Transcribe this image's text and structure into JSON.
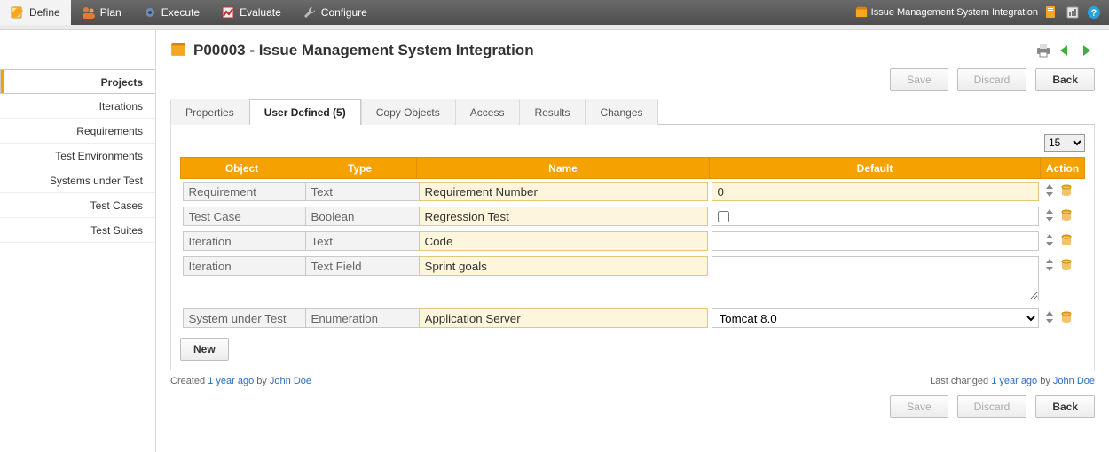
{
  "toolbar": {
    "tabs": [
      {
        "id": "define",
        "label": "Define",
        "icon": "pencil-note-icon"
      },
      {
        "id": "plan",
        "label": "Plan",
        "icon": "people-icon"
      },
      {
        "id": "execute",
        "label": "Execute",
        "icon": "gear-icon"
      },
      {
        "id": "evaluate",
        "label": "Evaluate",
        "icon": "chart-icon"
      },
      {
        "id": "configure",
        "label": "Configure",
        "icon": "wrench-icon"
      }
    ],
    "active_tab": "define",
    "context_label": "Issue Management System Integration",
    "right_icons": [
      "notes-icon",
      "reports-icon",
      "help-icon"
    ]
  },
  "sidebar": {
    "items": [
      {
        "label": "Projects"
      },
      {
        "label": "Iterations"
      },
      {
        "label": "Requirements"
      },
      {
        "label": "Test Environments"
      },
      {
        "label": "Systems under Test"
      },
      {
        "label": "Test Cases"
      },
      {
        "label": "Test Suites"
      }
    ],
    "active_index": 0
  },
  "page": {
    "title": "P00003 - Issue Management System Integration"
  },
  "actions": {
    "save_label": "Save",
    "discard_label": "Discard",
    "back_label": "Back",
    "new_label": "New"
  },
  "tabs": {
    "items": [
      {
        "label": "Properties"
      },
      {
        "label": "User Defined (5)"
      },
      {
        "label": "Copy Objects"
      },
      {
        "label": "Access"
      },
      {
        "label": "Results"
      },
      {
        "label": "Changes"
      }
    ],
    "active_index": 1
  },
  "page_size": {
    "value": "15",
    "options": [
      "15"
    ]
  },
  "columns": {
    "object": "Object",
    "type": "Type",
    "name": "Name",
    "default": "Default",
    "action": "Action"
  },
  "rows": [
    {
      "object": "Requirement",
      "type": "Text",
      "name": "Requirement Number",
      "default_kind": "text",
      "default": "0"
    },
    {
      "object": "Test Case",
      "type": "Boolean",
      "name": "Regression Test",
      "default_kind": "checkbox",
      "default_checked": false
    },
    {
      "object": "Iteration",
      "type": "Text",
      "name": "Code",
      "default_kind": "text",
      "default": ""
    },
    {
      "object": "Iteration",
      "type": "Text Field",
      "name": "Sprint goals",
      "default_kind": "textarea",
      "default": ""
    },
    {
      "object": "System under Test",
      "type": "Enumeration",
      "name": "Application Server",
      "default_kind": "select",
      "default": "Tomcat 8.0",
      "has_edit_icon": true
    }
  ],
  "meta": {
    "created_prefix": "Created ",
    "created_age": "1 year ago",
    "created_by": " by ",
    "created_user": "John Doe",
    "changed_prefix": "Last changed ",
    "changed_age": "1 year ago",
    "changed_by": " by ",
    "changed_user": "John Doe"
  }
}
